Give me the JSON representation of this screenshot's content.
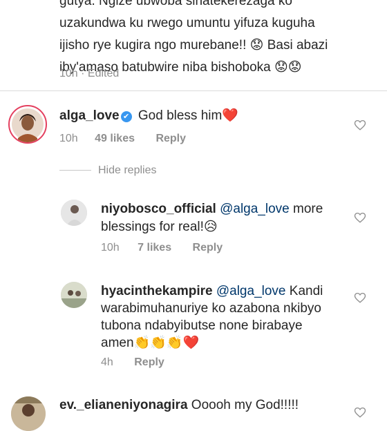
{
  "top_comment": {
    "text": "gutya. Ngize ubwoba sinatekerezaga ko\nuzakundwa ku rwego umuntu yifuza kuguha\nijisho rye kugira ngo murebane!! 😟 Basi abazi\niby'amaso batubwire niba bishoboka 😟😟",
    "time": "10h",
    "edited": "· Edited"
  },
  "comment_main": {
    "username": "alga_love",
    "verified_glyph": "✔",
    "text": "God bless him",
    "emoji": "❤️",
    "time": "10h",
    "likes": "49 likes",
    "reply_label": "Reply"
  },
  "hide_replies_label": "Hide replies",
  "replies": [
    {
      "username": "niyobosco_official",
      "mention": "@alga_love",
      "line1": "more",
      "line2": "blessings for real!",
      "emoji": "😥",
      "time": "10h",
      "likes": "7 likes",
      "reply_label": "Reply"
    },
    {
      "username": "hyacinthekampire",
      "mention": "@alga_love",
      "line1": "Kandi",
      "line2": "warabimuhanuriye ko azabona nkibyo",
      "line3": "tubona ndabyibutse none birabaye",
      "line4": "amen",
      "emoji": "👏👏👏❤️",
      "time": "4h",
      "reply_label": "Reply"
    }
  ],
  "comment_last": {
    "username": "ev._elianeniyonagira",
    "text": "Ooooh my God!!!!!"
  },
  "icons": {
    "like": "heart-outline-icon",
    "verified": "verified-badge-icon"
  },
  "colors": {
    "text": "#262626",
    "muted": "#8e8e8e",
    "mention": "#00376b",
    "verified": "#3897f0",
    "heart": "#ed1c24"
  }
}
